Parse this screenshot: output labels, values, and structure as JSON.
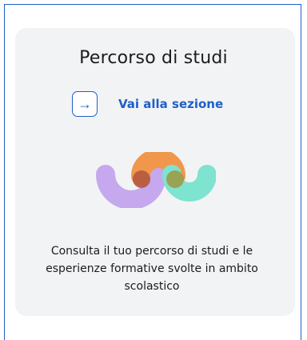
{
  "card": {
    "title": "Percorso di studi",
    "link_label": "Vai alla sezione",
    "arrow_icon": "→",
    "description": "Consulta il tuo percorso di studi e le esperienze formative svolte in ambito scolastico"
  },
  "colors": {
    "accent": "#1f5fc8",
    "card_bg": "#f2f3f5",
    "purple": "#c5a8ee",
    "orange": "#f0974c",
    "teal": "#7ee3cf"
  }
}
